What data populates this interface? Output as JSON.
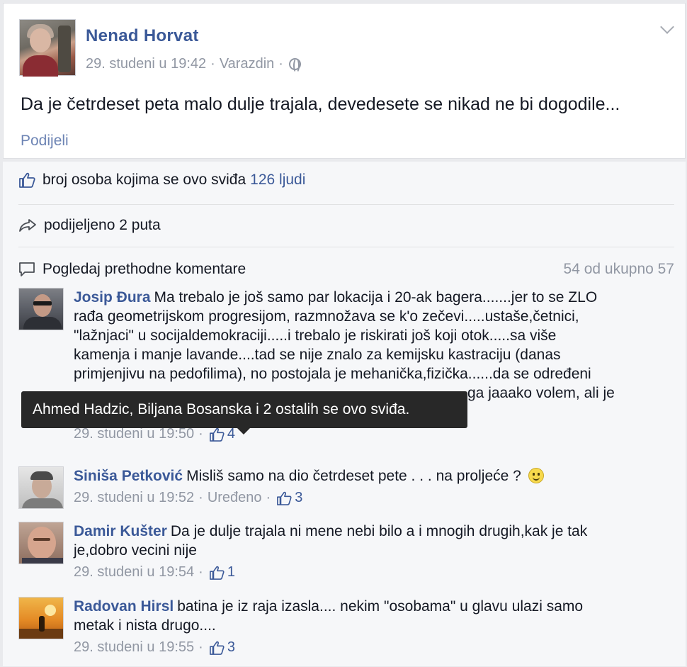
{
  "post": {
    "author": "Nenad Horvat",
    "date": "29. studeni u 19:42",
    "location": "Varazdin",
    "text": "Da je četrdeset peta malo dulje trajala, devedesete se nikad ne bi dogodile...",
    "share_label": "Podijeli"
  },
  "feedback": {
    "likes_label": "broj osoba kojima se ovo sviđa",
    "likes_value": "126 ljudi",
    "shares_label": "podijeljeno 2 puta",
    "prev_comments_label": "Pogledaj prethodne komentare",
    "comment_count": "54 od ukupno 57"
  },
  "tooltip": {
    "text": "Ahmed Hadzic, Biljana Bosanska i 2 ostalih se ovo sviđa."
  },
  "comments": [
    {
      "name": "Josip Đura",
      "line1": "Ma trebalo je još samo par lokacija i 20-ak bagera.......jer to se ZLO",
      "line2": "rađa geometrijskom progresijom, razmnožava se k'o zečevi.....ustaše,četnici,",
      "line3": "\"lažnjaci\" u socijaldemokraciji.....i trebalo je riskirati još koji otok.....sa više",
      "line4": "kamenja i manje lavande....tad se nije znalo za kemijsku kastraciju (danas",
      "line5": "primjenjivu na pedofilima), no postojala je mehanička,fizička......da se određeni",
      "line6": "ga jaaako volem, ali je",
      "date": "29. studeni u 19:50",
      "likes": "4"
    },
    {
      "name": "Siniša Petković",
      "text": "Misliš samo na dio četrdeset pete . . . na proljeće ?",
      "date": "29. studeni u 19:52",
      "edited": "Uređeno",
      "likes": "3"
    },
    {
      "name": "Damir Kušter",
      "line1": "Da je dulje trajala ni mene nebi bilo a i mnogih drugih,kak je tak",
      "line2": "je,dobro vecini nije",
      "date": "29. studeni u 19:54",
      "likes": "1"
    },
    {
      "name": "Radovan Hirsl",
      "line1": "batina je iz raja izasla.... nekim \"osobama\" u glavu ulazi samo",
      "line2": "metak i nista drugo....",
      "date": "29. studeni u 19:55",
      "likes": "3"
    }
  ],
  "icons": {
    "like": "thumbs-up-icon",
    "share": "share-arrow-icon",
    "comment": "speech-bubble-icon",
    "privacy": "globe-icon",
    "menu": "chevron-down-icon",
    "emoji": "smiley-icon"
  },
  "colors": {
    "link": "#3b5998",
    "meta": "#9197a3",
    "background": "#e9eaed",
    "tooltip": "#282828"
  }
}
